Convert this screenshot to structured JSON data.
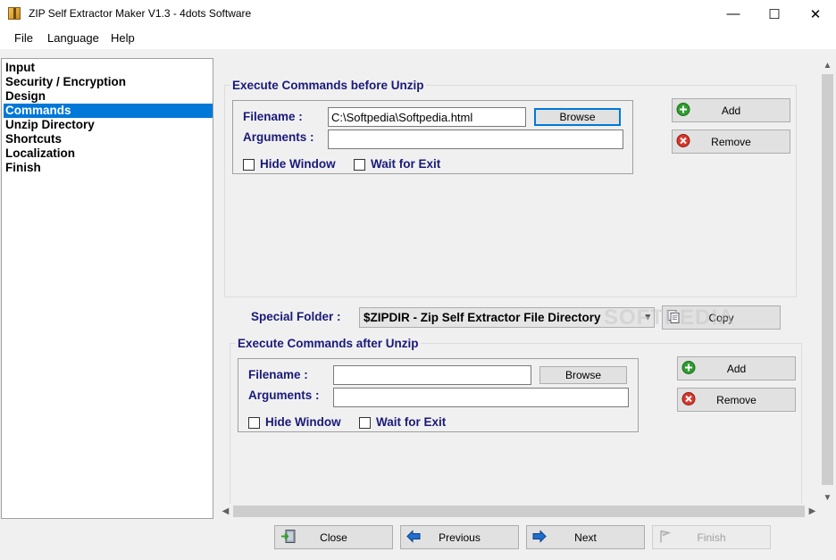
{
  "window": {
    "title": "ZIP Self Extractor Maker V1.3 - 4dots Software",
    "minimize_glyph": "—",
    "maximize_glyph": "☐",
    "close_glyph": "✕"
  },
  "menu": [
    "File",
    "Language",
    "Help"
  ],
  "nav": {
    "items": [
      "Input",
      "Security / Encryption",
      "Design",
      "Commands",
      "Unzip Directory",
      "Shortcuts",
      "Localization",
      "Finish"
    ],
    "selected_index": 3
  },
  "before": {
    "title": "Execute Commands before Unzip",
    "filename_label": "Filename :",
    "filename_value": "C:\\Softpedia\\Softpedia.html",
    "arguments_label": "Arguments :",
    "arguments_value": "",
    "browse_label": "Browse",
    "hide_window_label": "Hide Window",
    "wait_for_exit_label": "Wait for Exit",
    "add_label": "Add",
    "remove_label": "Remove"
  },
  "special_folder": {
    "label": "Special Folder :",
    "value": "$ZIPDIR - Zip Self Extractor File Directory",
    "copy_label": "Copy"
  },
  "after": {
    "title": "Execute Commands after Unzip",
    "filename_label": "Filename :",
    "filename_value": "",
    "arguments_label": "Arguments :",
    "arguments_value": "",
    "browse_label": "Browse",
    "hide_window_label": "Hide Window",
    "wait_for_exit_label": "Wait for Exit",
    "add_label": "Add",
    "remove_label": "Remove"
  },
  "watermark": "SOFTPEDIA",
  "footer": {
    "close_label": "Close",
    "previous_label": "Previous",
    "next_label": "Next",
    "finish_label": "Finish"
  },
  "colors": {
    "label_navy": "#1a1a7a",
    "selection": "#0078d7",
    "add_green": "#2e9e2e",
    "remove_red": "#d9362b",
    "arrow_blue": "#1f6fd1"
  }
}
